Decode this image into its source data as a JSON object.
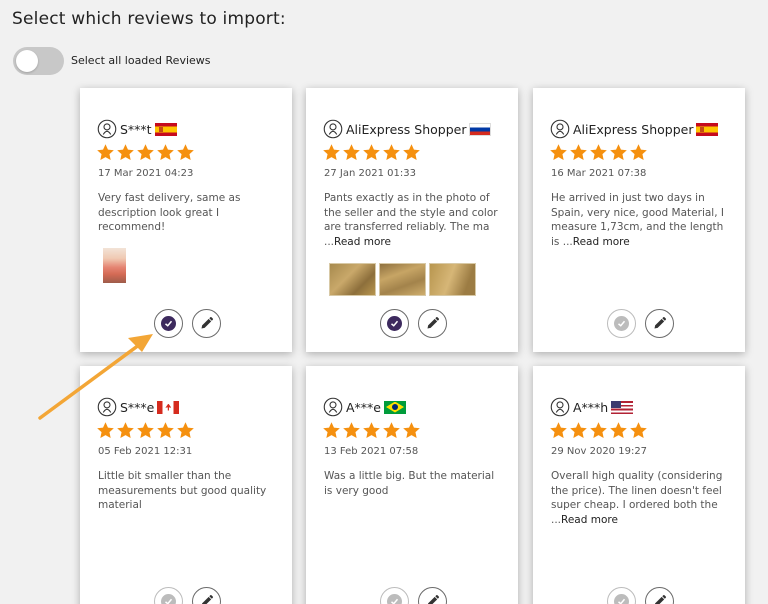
{
  "page": {
    "title": "Select which reviews to import:",
    "toggle_label": "Select all loaded Reviews",
    "toggle_on": false
  },
  "colors": {
    "star": "#f5900f",
    "selected_check": "#3d2a5e",
    "unselected_check": "#bcbcbc",
    "arrow": "#f3a636"
  },
  "reviews": [
    {
      "name": "S***t",
      "flag": "es-flag-icon",
      "rating": 5,
      "date": "17 Mar 2021 04:23",
      "text": "Very fast delivery, same as description look great I recommend!",
      "more": "",
      "media": "single-photo",
      "selected": true
    },
    {
      "name": "AliExpress Shopper",
      "flag": "ru-flag-icon",
      "rating": 5,
      "date": "27 Jan 2021 01:33",
      "text": "Pants exactly as in the photo of the seller and the style and color are transferred reliably. The ma ...",
      "more": "Read more",
      "media": "three-photos",
      "selected": true
    },
    {
      "name": "AliExpress Shopper",
      "flag": "es-flag-icon",
      "rating": 5,
      "date": "16 Mar 2021 07:38",
      "text": "He arrived in just two days in Spain, very nice, good Material, I measure 1,73cm, and the length is ...",
      "more": "Read more",
      "media": "none",
      "selected": false
    },
    {
      "name": "S***e",
      "flag": "ca-flag-icon",
      "rating": 5,
      "date": "05 Feb 2021 12:31",
      "text": "Little bit smaller than the measurements but good quality material",
      "more": "",
      "media": "none",
      "selected": false
    },
    {
      "name": "A***e",
      "flag": "br-flag-icon",
      "rating": 5,
      "date": "13 Feb 2021 07:58",
      "text": "Was a little big. But the material is very good",
      "more": "",
      "media": "none",
      "selected": false
    },
    {
      "name": "A***h",
      "flag": "us-flag-icon",
      "rating": 5,
      "date": "29 Nov 2020 19:27",
      "text": "Overall high quality (considering the price). The linen doesn't feel super cheap. I ordered both the ...",
      "more": "Read more",
      "media": "none",
      "selected": false
    }
  ]
}
